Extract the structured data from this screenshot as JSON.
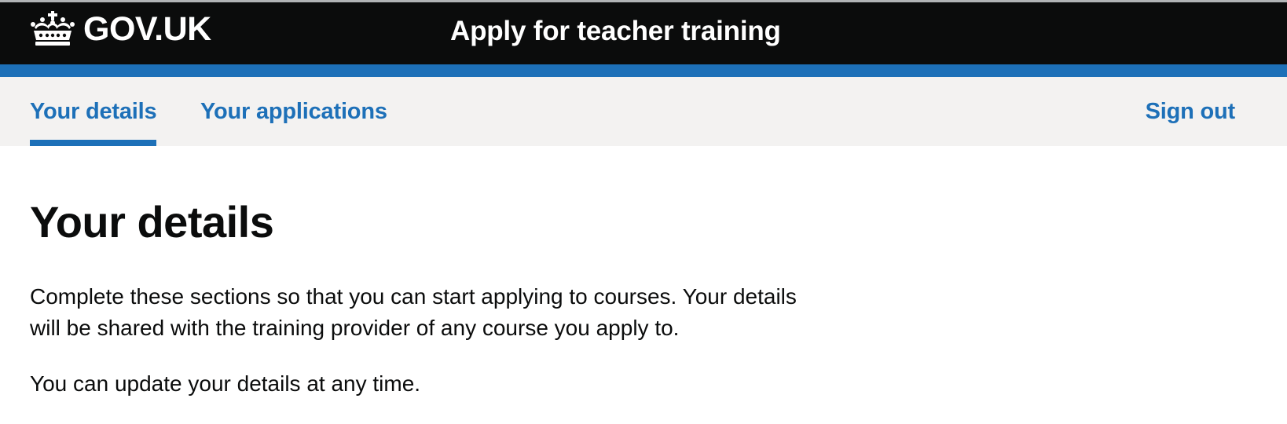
{
  "header": {
    "logo_text": "GOV.UK",
    "logo_icon": "crown-icon",
    "service_name": "Apply for teacher training"
  },
  "nav": {
    "items": [
      {
        "label": "Your details",
        "active": true
      },
      {
        "label": "Your applications",
        "active": false
      }
    ],
    "sign_out_label": "Sign out"
  },
  "main": {
    "title": "Your details",
    "paragraphs": [
      "Complete these sections so that you can start applying to courses. Your details will be shared with the training provider of any course you apply to.",
      "You can update your details at any time."
    ]
  },
  "colors": {
    "header_bg": "#0b0c0c",
    "brand_blue": "#1d70b8",
    "nav_bg": "#f3f2f1",
    "text": "#0b0c0c"
  }
}
